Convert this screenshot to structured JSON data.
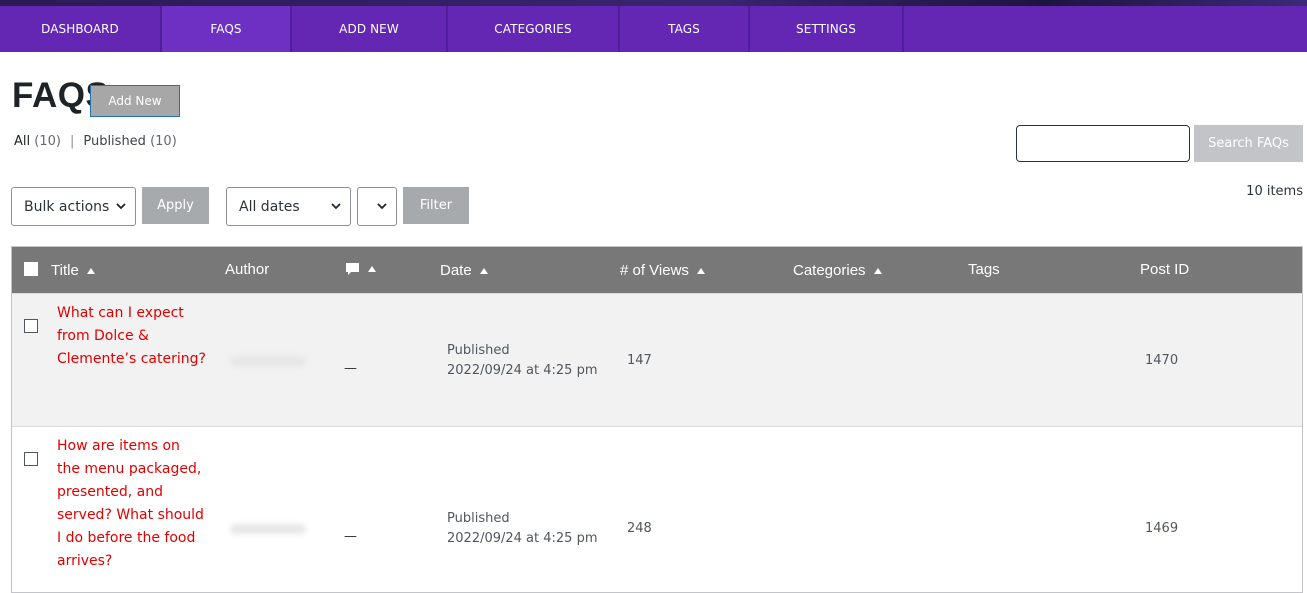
{
  "nav": {
    "tabs": [
      {
        "label": "DASHBOARD"
      },
      {
        "label": "FAQS"
      },
      {
        "label": "ADD NEW"
      },
      {
        "label": "CATEGORIES"
      },
      {
        "label": "TAGS"
      },
      {
        "label": "SETTINGS"
      }
    ],
    "active": "FAQS",
    "color": "#6327b4"
  },
  "header": {
    "title": "FAQS",
    "add_new_label": "Add New"
  },
  "filters": {
    "all_label": "All",
    "all_count": "(10)",
    "separator": "|",
    "published_label": "Published",
    "published_count": "(10)"
  },
  "search": {
    "value": "",
    "button_label": "Search FAQs"
  },
  "tablenav": {
    "bulk_actions": "Bulk actions",
    "apply_label": "Apply",
    "dates": "All dates",
    "category_select": "",
    "filter_label": "Filter",
    "items_count": "10 items"
  },
  "table": {
    "columns": {
      "title": "Title",
      "author": "Author",
      "comments_icon": "comment-icon",
      "date": "Date",
      "views": "# of Views",
      "categories": "Categories",
      "tags": "Tags",
      "post_id": "Post ID"
    },
    "rows": [
      {
        "title_lines": [
          "What can I expect",
          "from Dolce &",
          "Clemente’s catering?"
        ],
        "comments": "—",
        "status": "Published",
        "date": "2022/09/24 at 4:25 pm",
        "views": "147",
        "post_id": "1470"
      },
      {
        "title_lines": [
          "How are items on",
          "the menu packaged,",
          "presented, and",
          "served? What should",
          "I do before the food",
          "arrives?"
        ],
        "comments": "—",
        "status": "Published",
        "date": "2022/09/24 at 4:25 pm",
        "views": "248",
        "post_id": "1469"
      }
    ],
    "title_color": "#e00000",
    "header_color": "#787878"
  }
}
